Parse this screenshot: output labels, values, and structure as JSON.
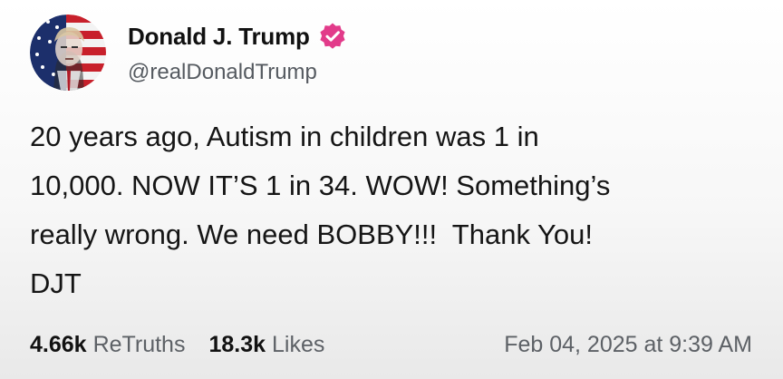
{
  "post": {
    "author": {
      "display_name": "Donald J. Trump",
      "handle": "@realDonaldTrump",
      "verified": true,
      "verified_badge_color": "#e23b8a"
    },
    "body_lines": [
      "20 years ago, Autism in children was 1 in",
      "10,000. NOW IT’S 1 in 34. WOW! Something’s",
      "really wrong. We need BOBBY!!!  Thank You!",
      "DJT"
    ],
    "stats": {
      "retruths_count": "4.66k",
      "retruths_label": "ReTruths",
      "likes_count": "18.3k",
      "likes_label": "Likes"
    },
    "timestamp": "Feb 04, 2025 at 9:39 AM"
  },
  "icons": {
    "avatar": "avatar-image",
    "verified": "verified-badge-icon"
  }
}
